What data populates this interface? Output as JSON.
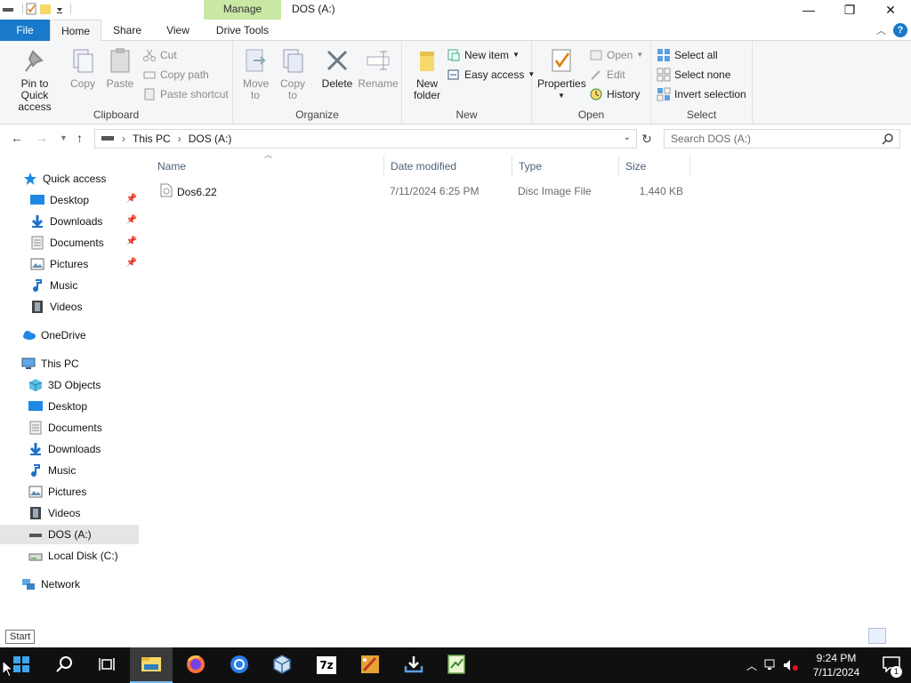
{
  "window": {
    "title": "DOS (A:)",
    "contextual_tab": "Manage",
    "controls": {
      "minimize": "—",
      "maximize": "❐",
      "close": "✕"
    }
  },
  "tabs": {
    "file": "File",
    "home": "Home",
    "share": "Share",
    "view": "View",
    "drive_tools": "Drive Tools"
  },
  "ribbon": {
    "clipboard": {
      "label": "Clipboard",
      "pin": "Pin to Quick access",
      "copy": "Copy",
      "paste": "Paste",
      "cut": "Cut",
      "copy_path": "Copy path",
      "paste_shortcut": "Paste shortcut"
    },
    "organize": {
      "label": "Organize",
      "move_to": "Move to",
      "copy_to": "Copy to",
      "delete": "Delete",
      "rename": "Rename"
    },
    "new": {
      "label": "New",
      "new_folder": "New folder",
      "new_item": "New item",
      "easy_access": "Easy access"
    },
    "open": {
      "label": "Open",
      "properties": "Properties",
      "open": "Open",
      "edit": "Edit",
      "history": "History"
    },
    "select": {
      "label": "Select",
      "select_all": "Select all",
      "select_none": "Select none",
      "invert": "Invert selection"
    }
  },
  "address": {
    "crumbs": [
      "This PC",
      "DOS (A:)"
    ],
    "search_placeholder": "Search DOS (A:)"
  },
  "nav": {
    "quick_access": "Quick access",
    "qa_items": [
      "Desktop",
      "Downloads",
      "Documents",
      "Pictures",
      "Music",
      "Videos"
    ],
    "onedrive": "OneDrive",
    "this_pc": "This PC",
    "pc_items": [
      "3D Objects",
      "Desktop",
      "Documents",
      "Downloads",
      "Music",
      "Pictures",
      "Videos",
      "DOS (A:)",
      "Local Disk (C:)"
    ],
    "network": "Network"
  },
  "columns": {
    "name": "Name",
    "date": "Date modified",
    "type": "Type",
    "size": "Size"
  },
  "files": [
    {
      "name": "Dos6.22",
      "date": "7/11/2024 6:25 PM",
      "type": "Disc Image File",
      "size": "1,440 KB"
    }
  ],
  "tooltip": "Start",
  "taskbar": {
    "time": "9:24 PM",
    "date": "7/11/2024",
    "notification_count": "1",
    "zip_label": "7z"
  },
  "colors": {
    "accent": "#1979ca",
    "manage": "#c9e8a4",
    "taskbar": "#101010"
  }
}
